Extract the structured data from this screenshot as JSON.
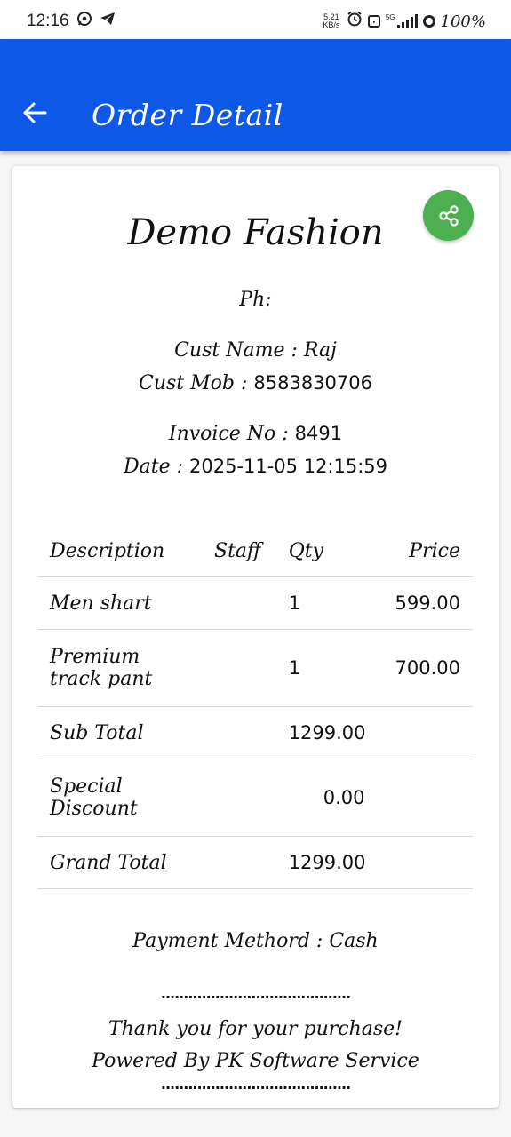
{
  "status_bar": {
    "time": "12:16",
    "net_speed_value": "5.21",
    "net_speed_unit": "KB/s",
    "network": "5G",
    "battery": "100%",
    "icons": [
      "whatsapp-icon",
      "telegram-icon",
      "alarm-icon",
      "vo-lte-icon",
      "signal-icon",
      "battery-icon"
    ]
  },
  "app_bar": {
    "title": "Order Detail",
    "back_icon": "arrow-left-icon",
    "color": "#0d58e6"
  },
  "receipt": {
    "share_icon": "share-icon",
    "share_color": "#4caf50",
    "shop_name": "Demo Fashion",
    "phone_label": "Ph:",
    "cust_name_label": "Cust Name : ",
    "cust_name": "Raj",
    "cust_mob_label": "Cust Mob : ",
    "cust_mob": "8583830706",
    "invoice_label": "Invoice No : ",
    "invoice_no": "8491",
    "date_label": "Date : ",
    "date": "2025-11-05 12:15:59",
    "columns": {
      "description": "Description",
      "staff": "Staff",
      "qty": "Qty",
      "price": "Price"
    },
    "items": [
      {
        "description": "Men shart",
        "staff": "",
        "qty": "1",
        "price": "599.00"
      },
      {
        "description": "Premium track pant",
        "staff": "",
        "qty": "1",
        "price": "700.00"
      }
    ],
    "summary": {
      "sub_total_label": "Sub Total",
      "sub_total": "1299.00",
      "special_discount_label": "Special Discount",
      "special_discount": "0.00",
      "grand_total_label": "Grand Total",
      "grand_total": "1299.00"
    },
    "payment_label": "Payment Methord : ",
    "payment_method": "Cash",
    "separator": "..........................................",
    "thank_you": "Thank you for your purchase!",
    "powered_by": "Powered By PK Software Service"
  }
}
